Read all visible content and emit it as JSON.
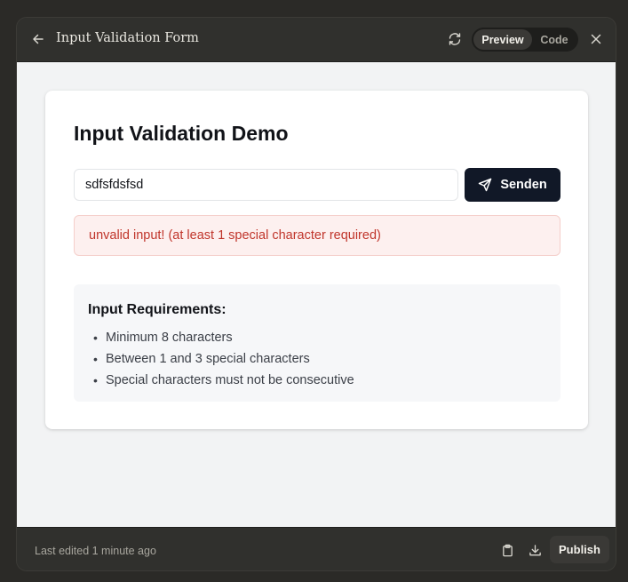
{
  "window": {
    "title": "Input Validation Form",
    "toggle": {
      "preview_label": "Preview",
      "code_label": "Code",
      "active": "Preview"
    }
  },
  "demo": {
    "heading": "Input Validation Demo",
    "input": {
      "value": "sdfsfdsfsd",
      "placeholder": ""
    },
    "send_label": "Senden",
    "error_message": "unvalid input! (at least 1 special character required)",
    "requirements": {
      "title": "Input Requirements:",
      "items": [
        "Minimum 8 characters",
        "Between 1 and 3 special characters",
        "Special characters must not be consecutive"
      ]
    }
  },
  "footer": {
    "last_edited": "Last edited 1 minute ago",
    "publish_label": "Publish"
  },
  "icons": {
    "back": "arrow-left-icon",
    "refresh": "refresh-icon",
    "close": "close-icon",
    "send": "send-icon",
    "clipboard": "clipboard-icon",
    "download": "download-icon"
  },
  "colors": {
    "error_text": "#c0352b",
    "error_bg": "#fdf0ef",
    "button_bg": "#111827"
  }
}
